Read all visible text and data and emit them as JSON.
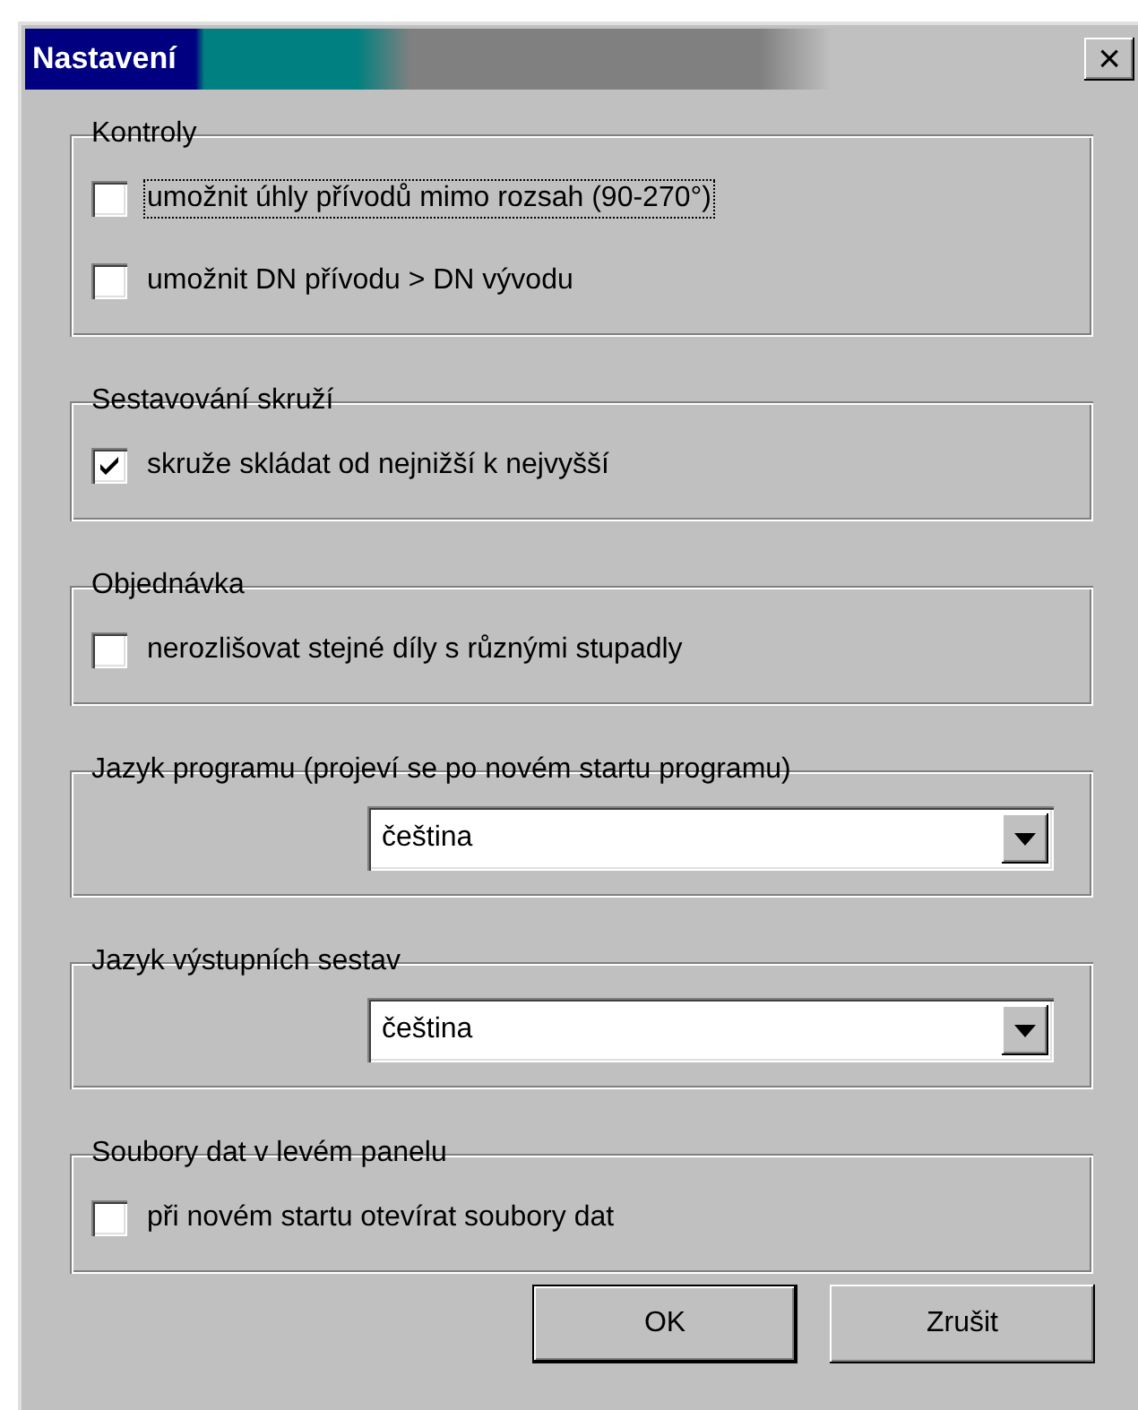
{
  "window": {
    "title": "Nastavení",
    "close": "×"
  },
  "groups": [
    {
      "title": "Kontroly",
      "items": [
        {
          "kind": "checkbox",
          "label": "umožnit úhly přívodů mimo rozsah (90-270°)",
          "checked": false,
          "focused": true
        },
        {
          "kind": "checkbox",
          "label": "umožnit DN přívodu > DN vývodu",
          "checked": false,
          "focused": false
        }
      ]
    },
    {
      "title": "Sestavování skruží",
      "items": [
        {
          "kind": "checkbox",
          "label": "skruže skládat od nejnižší k nejvyšší",
          "checked": true,
          "focused": false
        }
      ]
    },
    {
      "title": "Objednávka",
      "items": [
        {
          "kind": "checkbox",
          "label": "nerozlišovat stejné díly s různými stupadly",
          "checked": false,
          "focused": false
        }
      ]
    },
    {
      "title": "Jazyk programu (projeví se po novém startu programu)",
      "items": [
        {
          "kind": "dropdown",
          "value": "čeština"
        }
      ]
    },
    {
      "title": "Jazyk výstupních sestav",
      "items": [
        {
          "kind": "dropdown",
          "value": "čeština"
        }
      ]
    },
    {
      "title": "Soubory dat v levém panelu",
      "items": [
        {
          "kind": "checkbox",
          "label": "při novém startu otevírat soubory dat",
          "checked": false,
          "focused": false
        }
      ]
    }
  ],
  "buttons": [
    {
      "label": "OK",
      "default": true
    },
    {
      "label": "Zrušit",
      "default": false
    }
  ]
}
